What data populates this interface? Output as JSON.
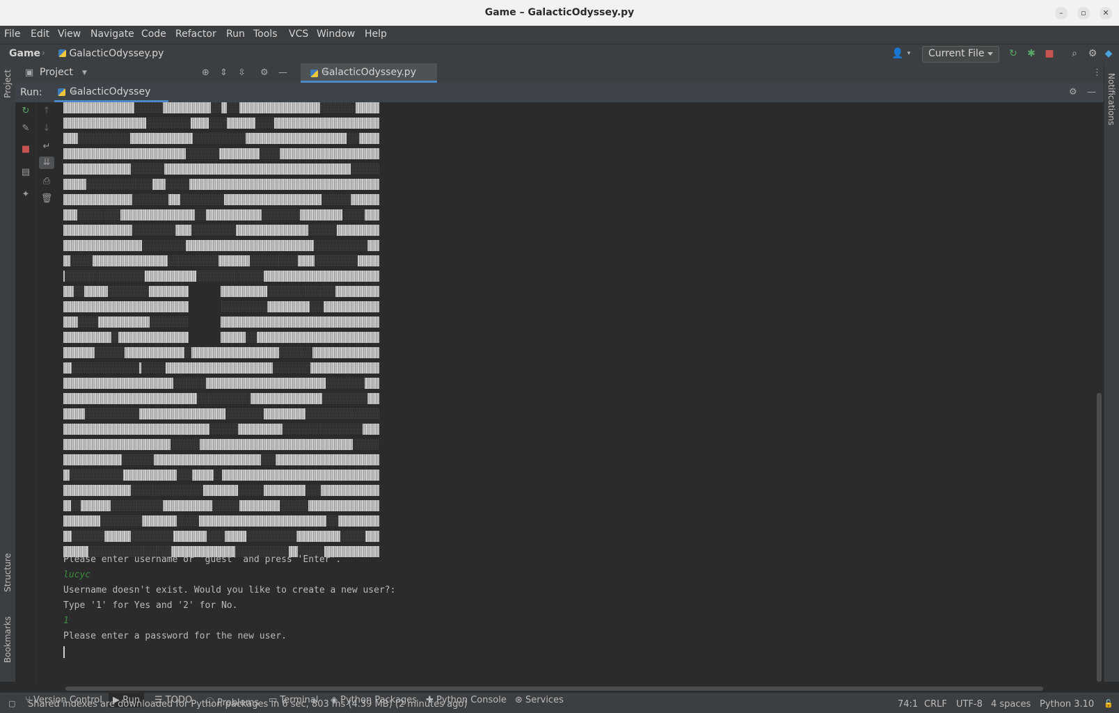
{
  "window": {
    "title": "Game – GalacticOdyssey.py"
  },
  "menu": [
    "File",
    "Edit",
    "View",
    "Navigate",
    "Code",
    "Refactor",
    "Run",
    "Tools",
    "VCS",
    "Window",
    "Help"
  ],
  "breadcrumb": {
    "project": "Game",
    "file": "GalacticOdyssey.py"
  },
  "run_config": {
    "label": "Current File"
  },
  "project_panel": {
    "title": "Project"
  },
  "editor_tab": {
    "label": "GalacticOdyssey.py"
  },
  "run_panel": {
    "label": "Run:",
    "tab": "GalacticOdyssey"
  },
  "sidebar": {
    "left_top": "Project",
    "left_structure": "Structure",
    "left_bookmarks": "Bookmarks",
    "right": "Notifications"
  },
  "console": {
    "lines": [
      {
        "text": "Please enter username or 'guest' and press 'Enter'.",
        "type": "output"
      },
      {
        "text": "lucyc",
        "type": "input"
      },
      {
        "text": "Username doesn't exist. Would you like to create a new user?:",
        "type": "output"
      },
      {
        "text": "Type '1' for Yes and '2' for No.",
        "type": "output"
      },
      {
        "text": "1",
        "type": "input"
      },
      {
        "text": "Please enter a password for the new user.",
        "type": "output"
      }
    ]
  },
  "bottom_tabs": [
    "Version Control",
    "Run",
    "TODO",
    "Problems",
    "Terminal",
    "Python Packages",
    "Python Console",
    "Services"
  ],
  "status": {
    "message": "Shared indexes are downloaded for Python packages in 6 sec, 803 ms (4.39 MB) (2 minutes ago)",
    "position": "74:1",
    "line_ending": "CRLF",
    "encoding": "UTF-8",
    "indent": "4 spaces",
    "interpreter": "Python 3.10"
  }
}
